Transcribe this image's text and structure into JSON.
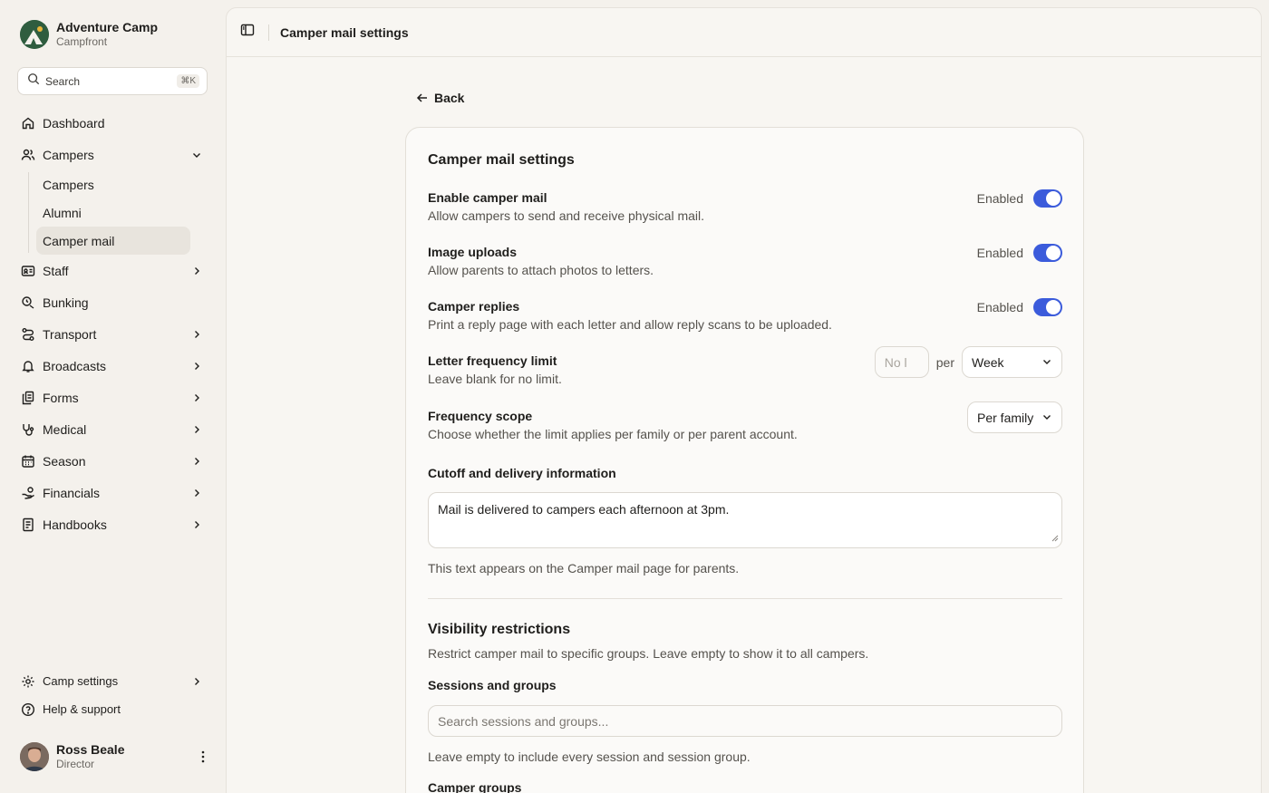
{
  "brand": {
    "title": "Adventure Camp",
    "subtitle": "Campfront"
  },
  "search": {
    "label": "Search",
    "shortcut": "⌘K"
  },
  "nav": {
    "dashboard": "Dashboard",
    "campers": "Campers",
    "campers_sub": [
      "Campers",
      "Alumni",
      "Camper mail"
    ],
    "staff": "Staff",
    "bunking": "Bunking",
    "transport": "Transport",
    "broadcasts": "Broadcasts",
    "forms": "Forms",
    "medical": "Medical",
    "season": "Season",
    "financials": "Financials",
    "handbooks": "Handbooks",
    "camp_settings": "Camp settings",
    "help": "Help & support"
  },
  "user": {
    "name": "Ross Beale",
    "role": "Director"
  },
  "topbar": {
    "title": "Camper mail settings"
  },
  "back": "Back",
  "settings": {
    "title": "Camper mail settings",
    "enable_mail": {
      "label": "Enable camper mail",
      "desc": "Allow campers to send and receive physical mail.",
      "status": "Enabled"
    },
    "image_uploads": {
      "label": "Image uploads",
      "desc": "Allow parents to attach photos to letters.",
      "status": "Enabled"
    },
    "replies": {
      "label": "Camper replies",
      "desc": "Print a reply page with each letter and allow reply scans to be uploaded.",
      "status": "Enabled"
    },
    "frequency": {
      "label": "Letter frequency limit",
      "desc": "Leave blank for no limit.",
      "placeholder": "No l",
      "per": "per",
      "period": "Week"
    },
    "scope": {
      "label": "Frequency scope",
      "desc": "Choose whether the limit applies per family or per parent account.",
      "value": "Per family"
    },
    "cutoff": {
      "label": "Cutoff and delivery information",
      "value": "Mail is delivered to campers each afternoon at 3pm.",
      "help": "This text appears on the Camper mail page for parents."
    },
    "visibility": {
      "title": "Visibility restrictions",
      "desc": "Restrict camper mail to specific groups. Leave empty to show it to all campers.",
      "sessions_label": "Sessions and groups",
      "sessions_placeholder": "Search sessions and groups...",
      "sessions_help": "Leave empty to include every session and session group.",
      "camper_groups_label": "Camper groups"
    }
  },
  "colors": {
    "accent": "#3b5bdb",
    "background": "#f4f1ec",
    "brand_logo": "#2f5d3f"
  }
}
